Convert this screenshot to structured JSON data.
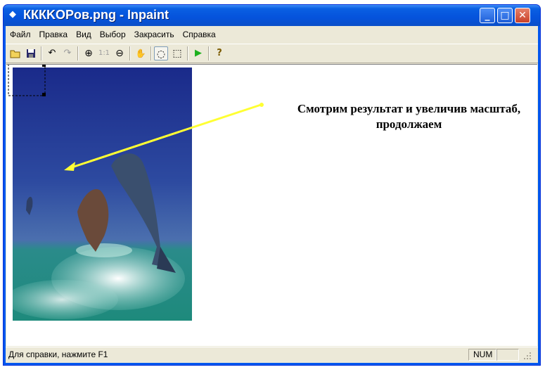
{
  "window": {
    "title": "КККKOPов.png - Inpaint",
    "title_icon": "diamond-icon",
    "accent": "#0553dc",
    "close_color": "#c9412a"
  },
  "menu": {
    "items": [
      "Файл",
      "Правка",
      "Вид",
      "Выбор",
      "Закрасить",
      "Справка"
    ]
  },
  "toolbar": {
    "tools": [
      {
        "name": "open-icon",
        "glyph": "📂"
      },
      {
        "name": "save-icon",
        "glyph": "💾"
      },
      {
        "name": "undo-icon",
        "glyph": "↶"
      },
      {
        "name": "redo-icon",
        "glyph": "↷"
      },
      {
        "name": "zoom-in-icon",
        "glyph": "⊕"
      },
      {
        "name": "zoom-actual-icon",
        "glyph": "1:1"
      },
      {
        "name": "zoom-out-icon",
        "glyph": "⊖"
      },
      {
        "name": "hand-icon",
        "glyph": "✋"
      },
      {
        "name": "lasso-icon",
        "glyph": "◌"
      },
      {
        "name": "rect-select-icon",
        "glyph": "⬚"
      },
      {
        "name": "run-icon",
        "glyph": "▶"
      },
      {
        "name": "help-icon",
        "glyph": "?"
      }
    ]
  },
  "canvas": {
    "annotation": "Смотрим результат и увеличив масштаб, продолжаем",
    "arrow_color": "#ffff00"
  },
  "status": {
    "text": "Для справки, нажмите F1",
    "num": "NUM"
  }
}
